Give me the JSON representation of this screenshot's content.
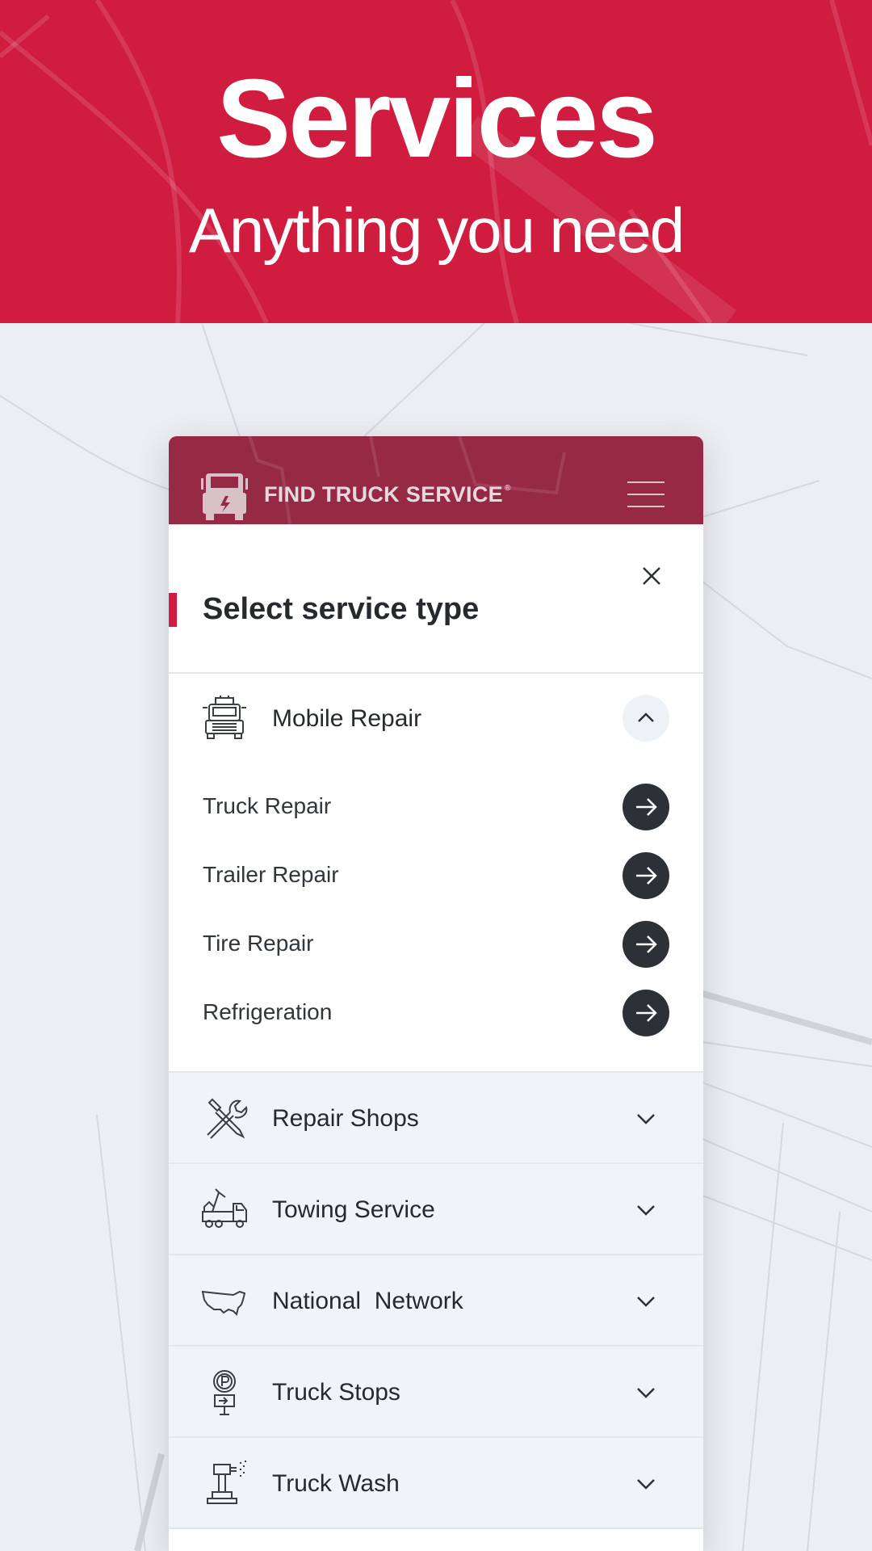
{
  "hero": {
    "title": "Services",
    "subtitle": "Anything you need"
  },
  "app": {
    "brand": "FIND TRUCK SERVICE",
    "brand_mark": "®",
    "sheet_title": "Select service type",
    "expanded_category": {
      "label": "Mobile Repair",
      "icon": "tow-truck-front-icon",
      "items": [
        {
          "label": "Truck Repair"
        },
        {
          "label": "Trailer Repair"
        },
        {
          "label": "Tire Repair"
        },
        {
          "label": "Refrigeration"
        }
      ]
    },
    "categories": [
      {
        "label": "Repair Shops",
        "icon": "wrench-screwdriver-icon"
      },
      {
        "label": "Towing Service",
        "icon": "tow-truck-icon"
      },
      {
        "label": "National  Network",
        "icon": "us-map-icon"
      },
      {
        "label": "Truck Stops",
        "icon": "parking-sign-icon"
      },
      {
        "label": "Truck Wash",
        "icon": "pressure-washer-icon"
      }
    ]
  },
  "colors": {
    "brand_red": "#cf1c3f",
    "appbar": "#962a45",
    "dark_button": "#2c3137",
    "category_bg": "#f1f4f7"
  }
}
